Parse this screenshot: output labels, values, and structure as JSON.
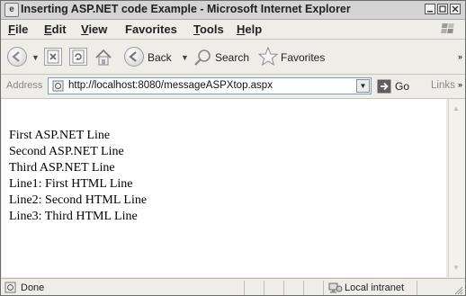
{
  "window": {
    "title": "Inserting ASP.NET code Example - Microsoft Internet Explorer"
  },
  "menubar": {
    "items": [
      {
        "first": "F",
        "rest": "ile"
      },
      {
        "first": "E",
        "rest": "dit"
      },
      {
        "first": "V",
        "rest": "iew"
      },
      {
        "first": "F",
        "pre": "",
        "rest": "avorites"
      },
      {
        "first": "T",
        "rest": "ools"
      },
      {
        "first": "H",
        "rest": "elp"
      }
    ]
  },
  "toolbar": {
    "back_label": "Back",
    "search_label": "Search",
    "favorites_label": "Favorites"
  },
  "addressbar": {
    "label": "Address",
    "url": "http://localhost:8080/messageASPXtop.aspx",
    "go_label": "Go",
    "links_label": "Links"
  },
  "content": {
    "lines": [
      "First ASP.NET Line",
      "Second ASP.NET Line",
      "Third ASP.NET Line",
      "Line1: First HTML Line",
      "Line2: Second HTML Line",
      "Line3: Third HTML Line"
    ]
  },
  "statusbar": {
    "status": "Done",
    "zone": "Local intranet"
  }
}
